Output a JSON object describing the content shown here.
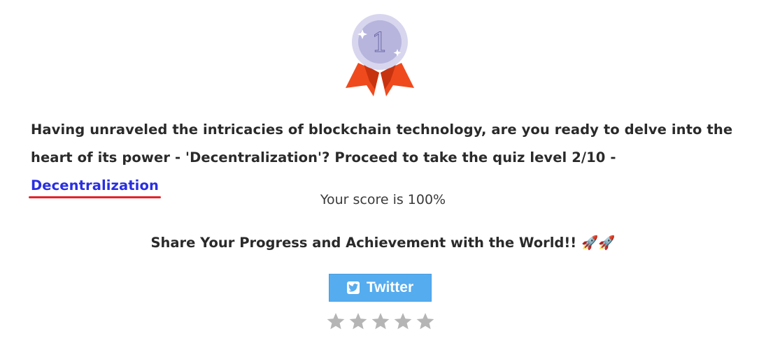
{
  "medal": {
    "number": "1",
    "icon": "medal-icon",
    "colors": {
      "disc_outer": "#d7d6ee",
      "disc_inner": "#b7b5dd",
      "ribbon": "#ef4a1e",
      "ribbon_dark": "#c7330f"
    }
  },
  "message": {
    "text": "Having unraveled the intricacies of blockchain technology, are you ready to delve into the heart of its power - 'Decentralization'? Proceed to take the quiz level 2/10 - ",
    "link_label": "Decentralization",
    "link_color": "#2a2fe0",
    "underline_color": "#e4242c"
  },
  "score": {
    "text": "Your score is 100%"
  },
  "share": {
    "text": "Share Your Progress and Achievement with the World!! ",
    "emoji": "🚀🚀"
  },
  "twitter": {
    "label": "Twitter",
    "icon": "twitter-icon",
    "color": "#55acee"
  },
  "rating": {
    "max": 5,
    "value": 0,
    "star_color": "#b5b5b5",
    "icon": "star-icon"
  }
}
